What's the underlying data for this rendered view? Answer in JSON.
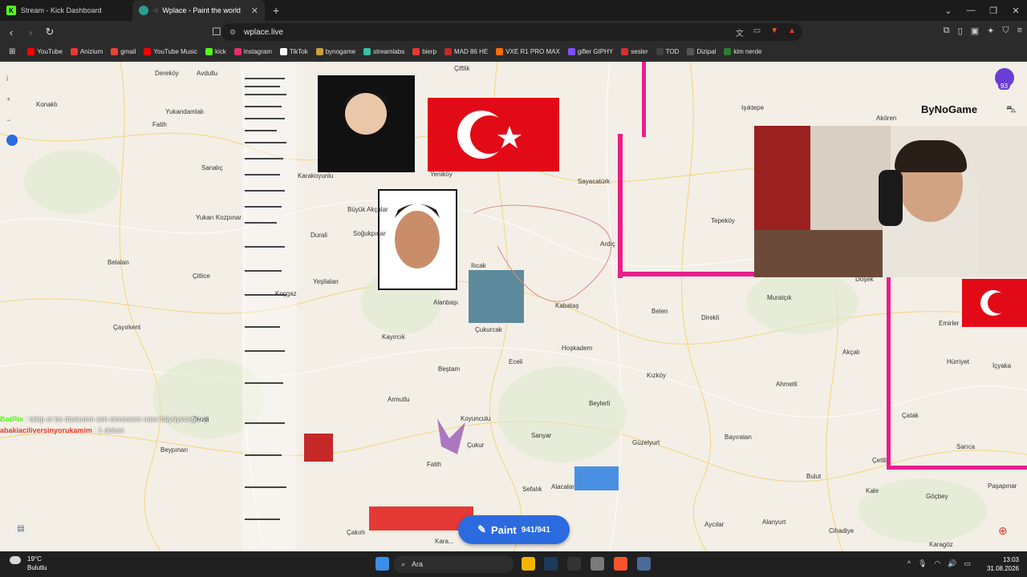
{
  "tabs": [
    {
      "title": "Stream - Kick Dashboard",
      "active": false
    },
    {
      "title": "Wplace - Paint the world",
      "active": true
    }
  ],
  "url": "wplace.live",
  "bookmarks": [
    "YouTube",
    "Anizium",
    "gmail",
    "YouTube Music",
    "kick",
    "instagram",
    "TikTok",
    "bynogame",
    "streamlabs",
    "bierp",
    "MAD 86 HE",
    "VXE R1 PRO MAX",
    "gifler GIPHY",
    "sesler",
    "TOD",
    "Dizipal",
    "kim nerde"
  ],
  "bookmark_colors": [
    "#ff0000",
    "#e53935",
    "#ea4335",
    "#ff0000",
    "#53fc18",
    "#e1306c",
    "#ffffff",
    "#c8a23c",
    "#31c3a2",
    "#e53935",
    "#c62828",
    "#ff6d00",
    "#7c4dff",
    "#d32f2f",
    "#424242",
    "#555555",
    "#2e7d32"
  ],
  "map": {
    "places": [
      {
        "name": "Dereköy"
      },
      {
        "name": "Avdullu"
      },
      {
        "name": "Konaklı"
      },
      {
        "name": "Yukandamlalı"
      },
      {
        "name": "Fatih"
      },
      {
        "name": "Çiftlik"
      },
      {
        "name": "Işıktepe"
      },
      {
        "name": "Akören"
      },
      {
        "name": "Karakoyunlu"
      },
      {
        "name": "Yeniköy"
      },
      {
        "name": "Sayacatürk"
      },
      {
        "name": "Sanalıç"
      },
      {
        "name": "Büyük Akçalar"
      },
      {
        "name": "Soğukpınar"
      },
      {
        "name": "Yukarı Kozpınar"
      },
      {
        "name": "Durali"
      },
      {
        "name": "Belalan"
      },
      {
        "name": "Çitlice"
      },
      {
        "name": "Ardıç"
      },
      {
        "name": "Tepeköy"
      },
      {
        "name": "Yeşilalan"
      },
      {
        "name": "Koçgaz"
      },
      {
        "name": "Ilıcak"
      },
      {
        "name": "Alanbaşı"
      },
      {
        "name": "Kabataş"
      },
      {
        "name": "Çukurcak"
      },
      {
        "name": "Çayırkent"
      },
      {
        "name": "Kayırcık"
      },
      {
        "name": "Hoşkadem"
      },
      {
        "name": "Belen"
      },
      {
        "name": "Direkli"
      },
      {
        "name": "Muratçık"
      },
      {
        "name": "Doşek"
      },
      {
        "name": "Emirler"
      },
      {
        "name": "Akçalı"
      },
      {
        "name": "Hürriyet"
      },
      {
        "name": "İçyaka"
      },
      {
        "name": "Beştam"
      },
      {
        "name": "Eceli"
      },
      {
        "name": "Kızköy"
      },
      {
        "name": "Ahmetli"
      },
      {
        "name": "Armutlu"
      },
      {
        "name": "Koyunculu"
      },
      {
        "name": "Beylerli"
      },
      {
        "name": "Terzili"
      },
      {
        "name": "Sanyar"
      },
      {
        "name": "Güzelyurt"
      },
      {
        "name": "Bayıralan"
      },
      {
        "name": "Çatak"
      },
      {
        "name": "Sarıca"
      },
      {
        "name": "Beypınarı"
      },
      {
        "name": "Çukur"
      },
      {
        "name": "Fatih"
      },
      {
        "name": "Alacalar"
      },
      {
        "name": "Sefalık"
      },
      {
        "name": "Bulut"
      },
      {
        "name": "Çetili"
      },
      {
        "name": "Kale"
      },
      {
        "name": "Göçbey"
      },
      {
        "name": "Paşapınar"
      },
      {
        "name": "Alanyurt"
      },
      {
        "name": "Cihadiye"
      },
      {
        "name": "Aycılar"
      },
      {
        "name": "Karagöz"
      },
      {
        "name": "Çakırlı"
      },
      {
        "name": "Kara..."
      }
    ],
    "paint_label": "Paint",
    "paint_count": "941/941",
    "brand": "ByNoGame",
    "notif_count": "93"
  },
  "chat": [
    {
      "user": "BotRix",
      "text": ": takip et be dostumm sen etmessen nasıl büyüyeceğiz :)",
      "user_color": "#53fc18"
    },
    {
      "user": "abakiaciliversinyorukamim",
      "text": ": 1 dolum",
      "user_color": "#e53935"
    }
  ],
  "taskbar": {
    "temp": "19°C",
    "weather": "Bulutlu",
    "search_placeholder": "Ara",
    "time": "13:03",
    "date": "31.08.2026"
  }
}
